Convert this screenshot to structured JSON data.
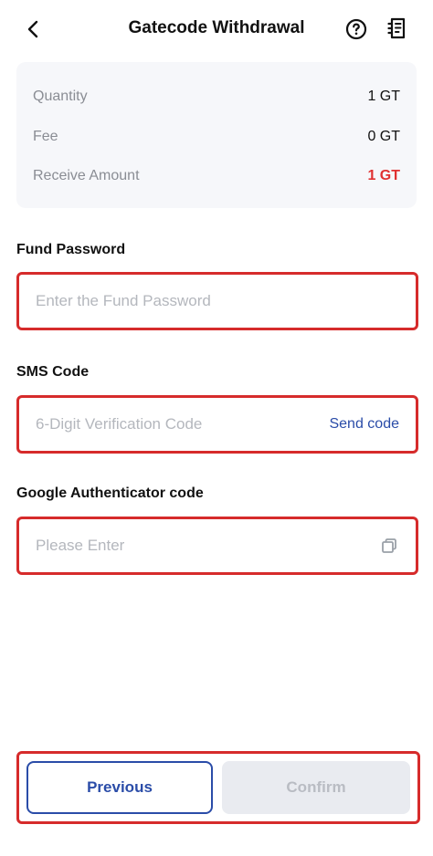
{
  "header": {
    "title": "Gatecode Withdrawal",
    "back_icon": "chevron-left-icon",
    "help_icon": "question-circle-icon",
    "records_icon": "receipt-icon"
  },
  "summary": {
    "rows": [
      {
        "label": "Quantity",
        "value": "1 GT"
      },
      {
        "label": "Fee",
        "value": "0 GT"
      },
      {
        "label": "Receive Amount",
        "value": "1 GT"
      }
    ],
    "highlight_color": "#e03131"
  },
  "form": {
    "fund_password": {
      "label": "Fund Password",
      "placeholder": "Enter the Fund Password",
      "value": ""
    },
    "sms_code": {
      "label": "SMS Code",
      "placeholder": "6-Digit Verification Code",
      "value": "",
      "send_label": "Send code"
    },
    "google_auth": {
      "label": "Google Authenticator code",
      "placeholder": "Please Enter",
      "value": "",
      "paste_icon": "paste-icon"
    }
  },
  "actions": {
    "previous_label": "Previous",
    "confirm_label": "Confirm"
  },
  "colors": {
    "accent": "#2a4ca8",
    "highlight_border": "#d62b2b",
    "disabled_bg": "#e9ebf0"
  }
}
